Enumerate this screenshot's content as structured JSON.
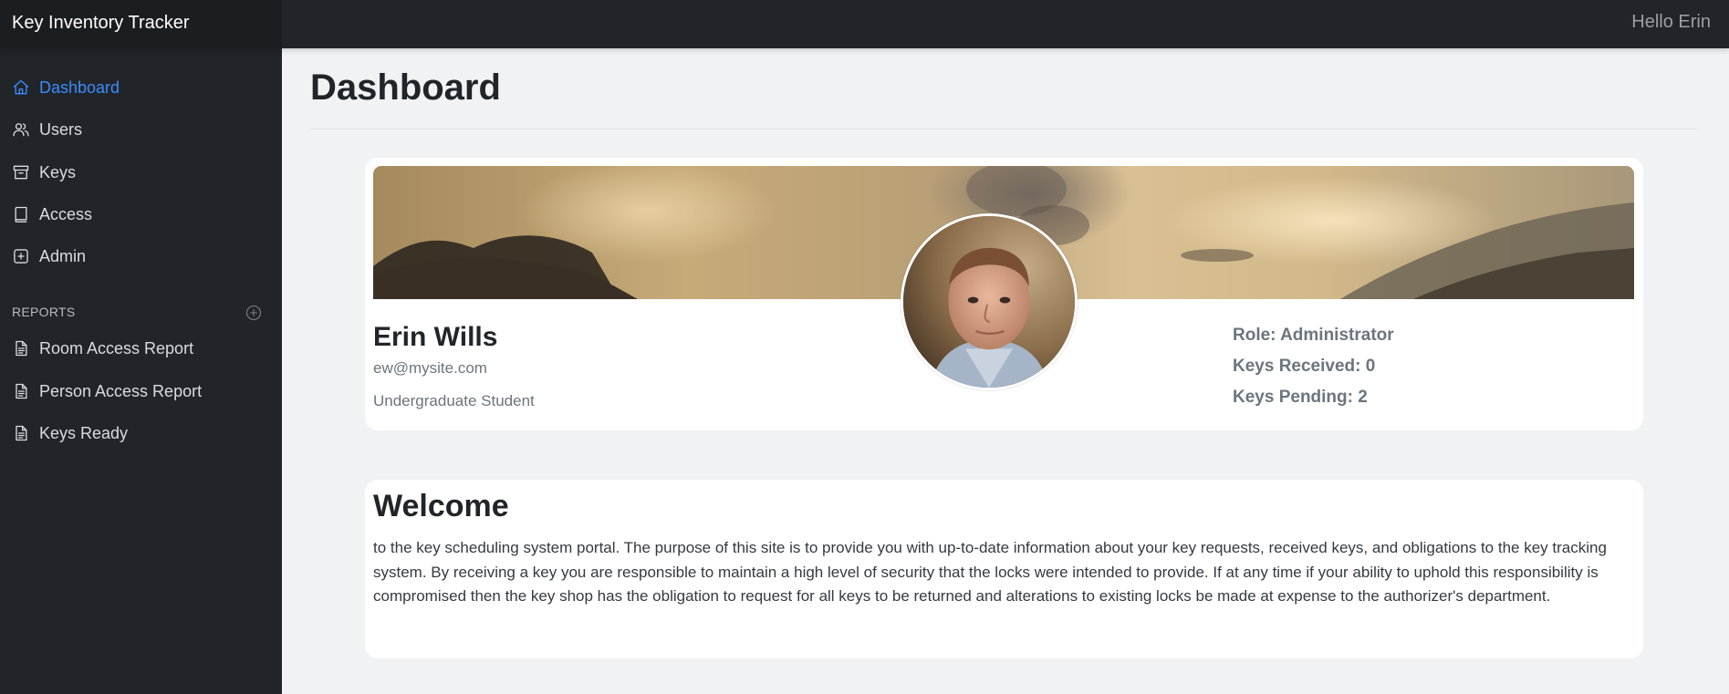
{
  "app": {
    "title": "Key Inventory Tracker",
    "greeting": "Hello Erin"
  },
  "sidebar": {
    "items": [
      {
        "label": "Dashboard",
        "icon": "home-icon",
        "active": true
      },
      {
        "label": "Users",
        "icon": "users-icon"
      },
      {
        "label": "Keys",
        "icon": "archive-icon"
      },
      {
        "label": "Access",
        "icon": "book-icon"
      },
      {
        "label": "Admin",
        "icon": "plus-square-icon"
      }
    ],
    "reports_heading": "REPORTS",
    "reports": [
      {
        "label": "Room Access Report",
        "icon": "file-text-icon"
      },
      {
        "label": "Person Access Report",
        "icon": "file-text-icon"
      },
      {
        "label": "Keys Ready",
        "icon": "file-text-icon"
      }
    ]
  },
  "main": {
    "title": "Dashboard",
    "profile": {
      "name": "Erin Wills",
      "email": "ew@mysite.com",
      "role_label": "Undergraduate Student",
      "stats": {
        "role": "Role: Administrator",
        "received": "Keys Received: 0",
        "pending": "Keys Pending: 2"
      }
    },
    "welcome": {
      "title": "Welcome",
      "text": "to the key scheduling system portal. The purpose of this site is to provide you with up-to-date information about your key requests, received keys, and obligations to the key tracking system. By receiving a key you are responsible to maintain a high level of security that the locks were intended to provide. If at any time if your ability to uphold this responsibility is compromised then the key shop has the obligation to request for all keys to be returned and alterations to existing locks be made at expense to the authorizer's department."
    }
  },
  "colors": {
    "sidebar_bg": "#212529",
    "active_link": "#3d8bfd",
    "page_bg": "#f1f2f4",
    "muted_text": "#6c757d"
  }
}
